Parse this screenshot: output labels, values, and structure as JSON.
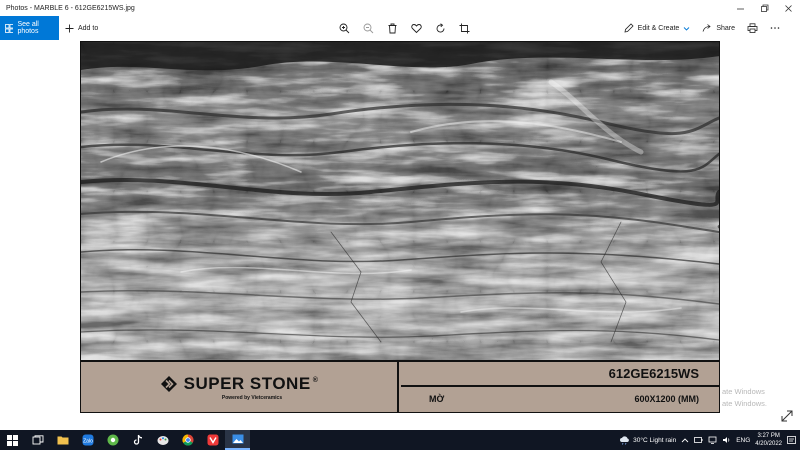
{
  "window": {
    "title": "Photos - MARBLE 6 - 612GE6215WS.jpg",
    "controls": [
      "minimize",
      "maximize",
      "close"
    ]
  },
  "toolbar": {
    "see_all_label": "See all photos",
    "add_to_label": "Add to",
    "tools": [
      "zoom-in-icon",
      "zoom-out-icon",
      "delete-icon",
      "favorite-icon",
      "rotate-icon",
      "crop-icon"
    ],
    "edit_create_label": "Edit & Create",
    "share_label": "Share"
  },
  "product": {
    "brand": "SUPER STONE",
    "brand_mark": "®",
    "tagline": "Powered by Vietceramics",
    "code": "612GE6215WS",
    "finish": "MỜ",
    "size": "600X1200 (MM)",
    "panel_color": "#b2a194"
  },
  "watermark": {
    "line1": "ate Windows",
    "line2": "ate Windows."
  },
  "taskbar": {
    "apps": [
      "windows-start",
      "task-view",
      "file-explorer",
      "zalo",
      "greenshot",
      "tiktok",
      "paint",
      "chrome",
      "vivaldi",
      "photos"
    ],
    "weather": "30°C  Light rain",
    "language": "ENG",
    "time": "3:27 PM",
    "date": "4/20/2022"
  },
  "colors": {
    "accent": "#0078d7",
    "taskbar": "#101623"
  }
}
